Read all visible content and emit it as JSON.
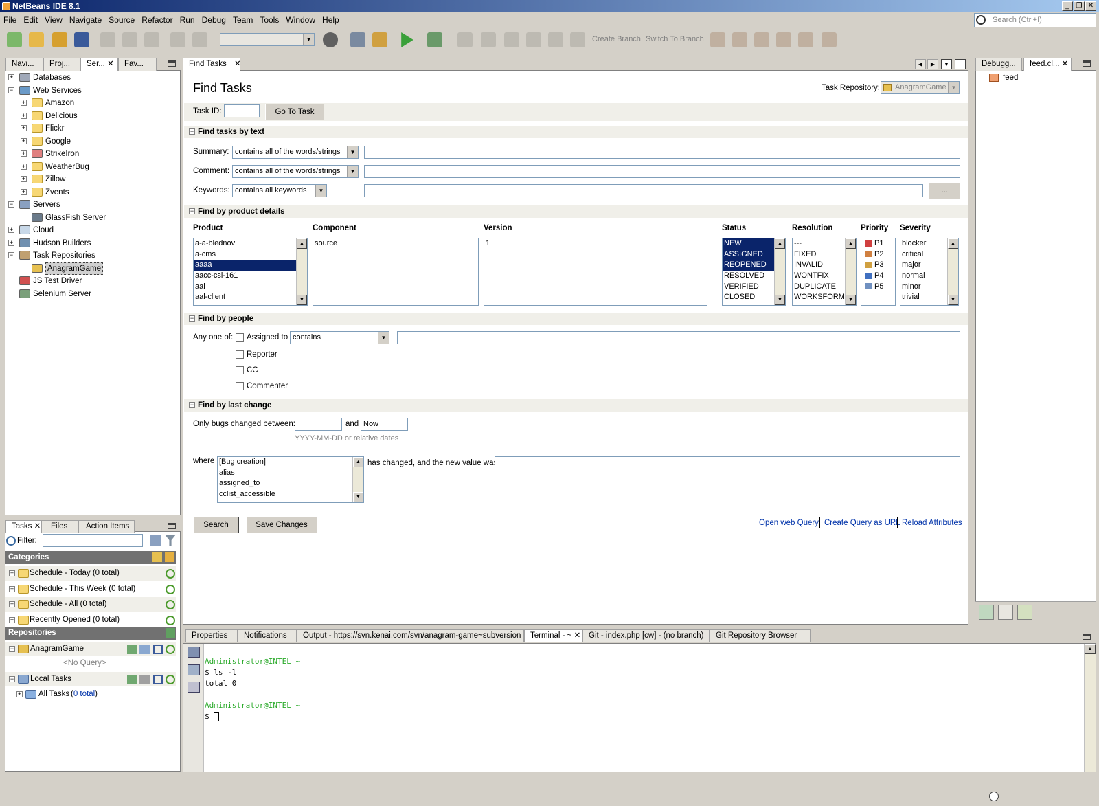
{
  "window": {
    "title": "NetBeans IDE 8.1"
  },
  "menu": [
    "File",
    "Edit",
    "View",
    "Navigate",
    "Source",
    "Refactor",
    "Run",
    "Debug",
    "Team",
    "Tools",
    "Window",
    "Help"
  ],
  "search": {
    "placeholder": "Search (Ctrl+I)"
  },
  "toolbar": {
    "create_branch": "Create Branch",
    "switch_branch": "Switch To Branch"
  },
  "left_tabs": [
    "Navi...",
    "Proj...",
    "Ser...",
    "Fav..."
  ],
  "services_tree": [
    {
      "label": "Databases",
      "level": 0,
      "exp": "+",
      "icon": "database-icon"
    },
    {
      "label": "Web Services",
      "level": 0,
      "exp": "-",
      "icon": "web-services-icon"
    },
    {
      "label": "Amazon",
      "level": 1,
      "exp": "+",
      "icon": "folder-icon"
    },
    {
      "label": "Delicious",
      "level": 1,
      "exp": "+",
      "icon": "folder-icon"
    },
    {
      "label": "Flickr",
      "level": 1,
      "exp": "+",
      "icon": "folder-icon"
    },
    {
      "label": "Google",
      "level": 1,
      "exp": "+",
      "icon": "folder-icon"
    },
    {
      "label": "StrikeIron",
      "level": 1,
      "exp": "+",
      "icon": "strikeiron-icon"
    },
    {
      "label": "WeatherBug",
      "level": 1,
      "exp": "+",
      "icon": "folder-icon"
    },
    {
      "label": "Zillow",
      "level": 1,
      "exp": "+",
      "icon": "folder-icon"
    },
    {
      "label": "Zvents",
      "level": 1,
      "exp": "+",
      "icon": "folder-icon"
    },
    {
      "label": "Servers",
      "level": 0,
      "exp": "-",
      "icon": "servers-icon"
    },
    {
      "label": "GlassFish Server",
      "level": 1,
      "exp": "",
      "icon": "glassfish-icon"
    },
    {
      "label": "Cloud",
      "level": 0,
      "exp": "+",
      "icon": "cloud-icon"
    },
    {
      "label": "Hudson Builders",
      "level": 0,
      "exp": "+",
      "icon": "hudson-icon"
    },
    {
      "label": "Task Repositories",
      "level": 0,
      "exp": "-",
      "icon": "task-repositories-icon"
    },
    {
      "label": "AnagramGame",
      "level": 1,
      "exp": "",
      "icon": "repository-icon",
      "selected": true
    },
    {
      "label": "JS Test Driver",
      "level": 0,
      "exp": "",
      "icon": "js-test-driver-icon"
    },
    {
      "label": "Selenium Server",
      "level": 0,
      "exp": "",
      "icon": "selenium-icon"
    }
  ],
  "tasks_panel": {
    "tabs": [
      "Tasks",
      "Files",
      "Action Items"
    ],
    "filter_label": "Filter:",
    "categories_label": "Categories",
    "categories": [
      "Schedule - Today  (0 total)",
      "Schedule - This Week  (0 total)",
      "Schedule - All  (0 total)",
      "Recently Opened  (0 total)"
    ],
    "repositories_label": "Repositories",
    "repo_anagram": "AnagramGame",
    "no_query": "<No Query>",
    "local_tasks": "Local Tasks",
    "all_tasks": "All Tasks",
    "all_tasks_count": "0 total"
  },
  "editor_tab": "Find Tasks",
  "find": {
    "title": "Find Tasks",
    "task_repository_label": "Task Repository:",
    "task_repository_value": "AnagramGame",
    "task_id_label": "Task ID:",
    "go_to_task": "Go To Task",
    "sec_text": "Find tasks by text",
    "summary_label": "Summary:",
    "summary_mode": "contains all of the words/strings",
    "comment_label": "Comment:",
    "comment_mode": "contains all of the words/strings",
    "keywords_label": "Keywords:",
    "keywords_mode": "contains all keywords",
    "keywords_btn": "...",
    "sec_product": "Find by product details",
    "product_label": "Product",
    "component_label": "Component",
    "version_label": "Version",
    "status_label": "Status",
    "resolution_label": "Resolution",
    "priority_label": "Priority",
    "severity_label": "Severity",
    "products": [
      "a-a-blednov",
      "a-cms",
      "aaaa",
      "aacc-csi-161",
      "aal",
      "aal-client"
    ],
    "components": [
      "source"
    ],
    "versions": [
      "1"
    ],
    "statuses": [
      "NEW",
      "ASSIGNED",
      "REOPENED",
      "RESOLVED",
      "VERIFIED",
      "CLOSED"
    ],
    "resolutions": [
      "---",
      "FIXED",
      "INVALID",
      "WONTFIX",
      "DUPLICATE",
      "WORKSFORME"
    ],
    "priorities": [
      "P1",
      "P2",
      "P3",
      "P4",
      "P5"
    ],
    "severities": [
      "blocker",
      "critical",
      "major",
      "normal",
      "minor",
      "trivial"
    ],
    "sec_people": "Find by people",
    "any_one_of": "Any one of:",
    "assigned_to": "Assigned to",
    "people_mode": "contains",
    "reporter": "Reporter",
    "cc": "CC",
    "commenter": "Commenter",
    "sec_change": "Find by last change",
    "only_bugs_changed": "Only bugs changed between:",
    "and_label": "and",
    "to_value": "Now",
    "date_hint": "YYYY-MM-DD or relative dates",
    "where_label": "where",
    "fields": [
      "[Bug creation]",
      "alias",
      "assigned_to",
      "cclist_accessible"
    ],
    "has_changed": "has changed, and the new value was",
    "search_btn": "Search",
    "save_btn": "Save Changes",
    "open_web_query": "Open web Query",
    "create_query_url": "Create Query as URL",
    "reload_attributes": "Reload Attributes"
  },
  "right_tabs": [
    "Debugg...",
    "feed.cl..."
  ],
  "right_tree_item": "feed",
  "bottom_tabs": [
    "Properties",
    "Notifications",
    "Output - https://svn.kenai.com/svn/anagram-game~subversion",
    "Terminal - ~",
    "Git - index.php [cw] - (no branch)",
    "Git Repository Browser"
  ],
  "terminal": {
    "prompt1": "Administrator@INTEL ~",
    "cmd1": "$ ls -l",
    "out1": "total 0",
    "prompt2": "Administrator@INTEL ~",
    "cmd2": "$ "
  }
}
